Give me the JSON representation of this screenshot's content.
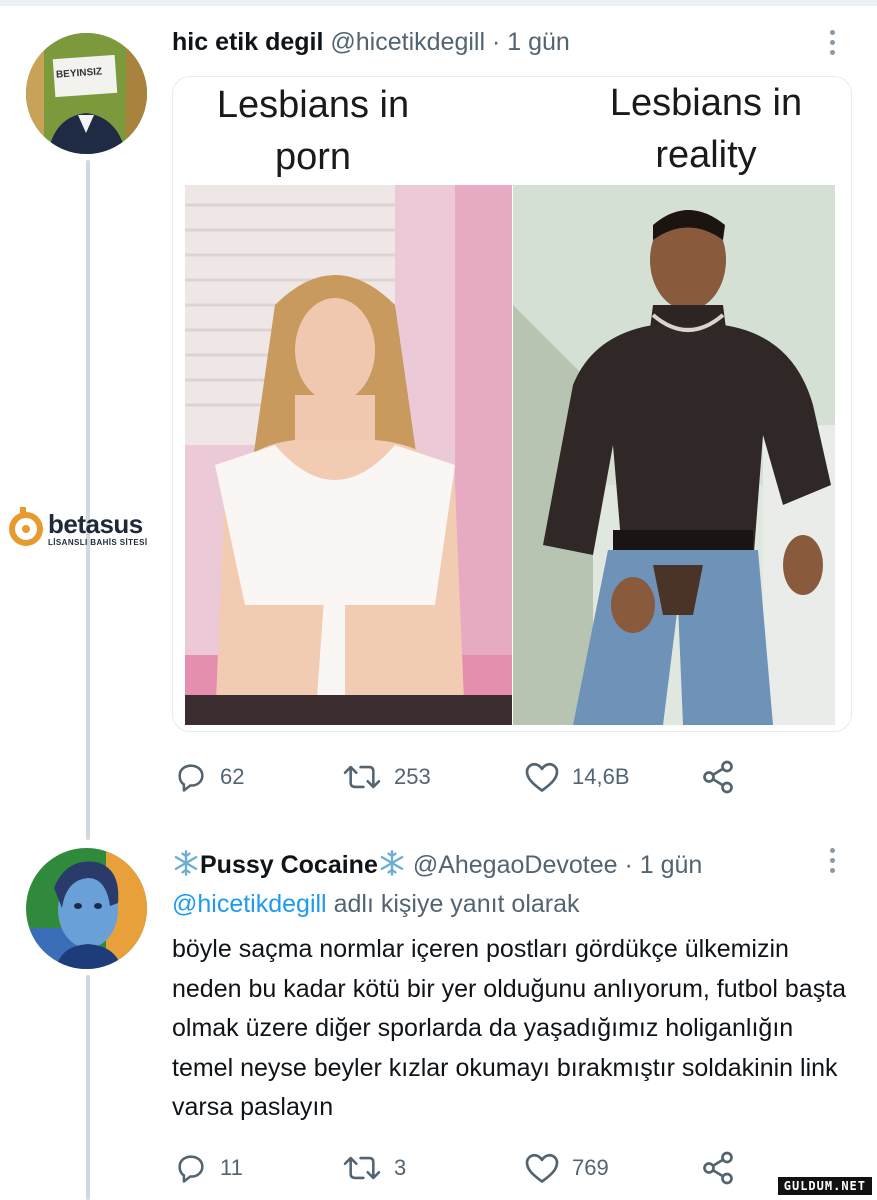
{
  "tweet1": {
    "name": "hic etik degil",
    "handle": "@hicetikdegill",
    "dot": "·",
    "time": "1 gün",
    "avatar_sign": "BEYINSIZ",
    "meme": {
      "left_caption": "Lesbians in porn",
      "right_caption": "Lesbians in reality"
    },
    "actions": {
      "reply_count": "62",
      "retweet_count": "253",
      "like_count": "14,6B"
    }
  },
  "tweet2": {
    "name": "Pussy Cocaine",
    "name_icon": "snowflake-icon",
    "handle": "@AhegaoDevotee",
    "dot": "·",
    "time": "1 gün",
    "reply_mention": "@hicetikdegill",
    "reply_suffix": "adlı kişiye yanıt olarak",
    "text": "böyle saçma normlar içeren postları gördükçe ülkemizin neden bu kadar kötü bir yer olduğunu anlıyorum, futbol başta olmak üzere diğer sporlarda da yaşadığımız holiganlığın temel neyse beyler kızlar okumayı bırakmıştır soldakinin link varsa paslayın",
    "actions": {
      "reply_count": "11",
      "retweet_count": "3",
      "like_count": "769"
    }
  },
  "watermark": {
    "logo_o": "O",
    "logo": "betasus",
    "sub": "LİSANSLI BAHİS SİTESİ"
  },
  "corner_watermark": "GULDUM.NET",
  "colors": {
    "text": "#0f1419",
    "secondary": "#536471",
    "link": "#1d9bf0",
    "thread_line": "#cfd9de",
    "brand_orange": "#e79a2e"
  }
}
